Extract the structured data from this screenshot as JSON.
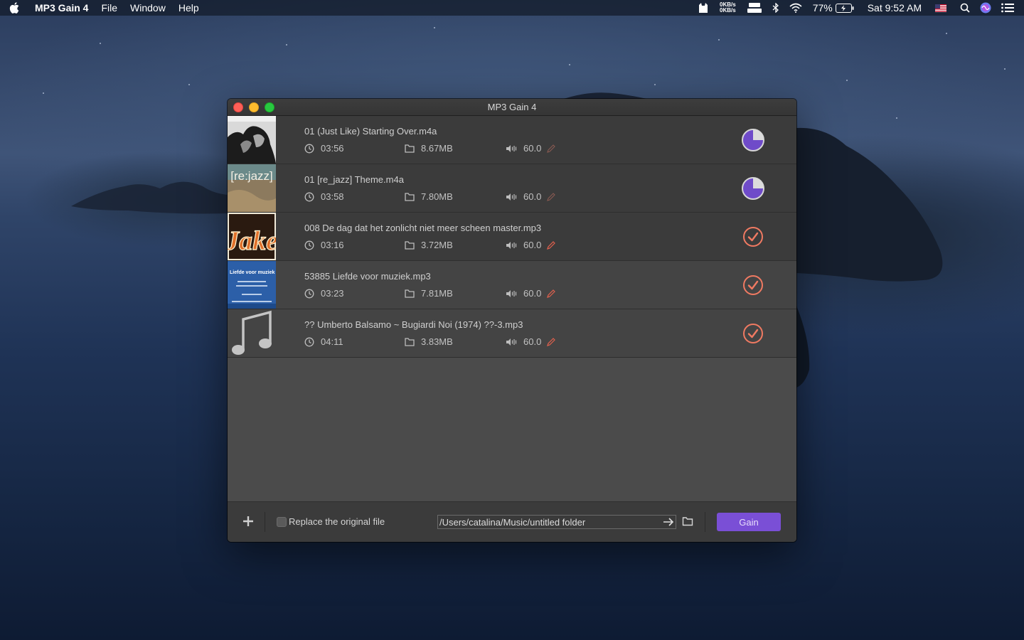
{
  "menubar": {
    "app_name": "MP3 Gain 4",
    "menus": [
      "File",
      "Window",
      "Help"
    ],
    "net_up": "0KB/s",
    "net_down": "0KB/s",
    "battery": "77%",
    "clock": "Sat 9:52 AM",
    "icons": [
      "apple-logo-icon",
      "cat-icon",
      "drive-icon",
      "bluetooth-icon",
      "wifi-icon",
      "battery-icon",
      "us-flag-icon",
      "spotlight-icon",
      "siri-icon",
      "notification-center-icon"
    ]
  },
  "window": {
    "title": "MP3 Gain 4"
  },
  "files": [
    {
      "name": "01 (Just Like) Starting Over.m4a",
      "duration": "03:56",
      "size": "8.67MB",
      "volume": "60.0",
      "status": "processing",
      "status_icon": "progress-pie-icon"
    },
    {
      "name": "01 [re_jazz] Theme.m4a",
      "duration": "03:58",
      "size": "7.80MB",
      "volume": "60.0",
      "status": "processing",
      "status_icon": "progress-pie-icon",
      "art_text": "[re:jazz]"
    },
    {
      "name": "008 De dag dat het zonlicht niet meer scheen master.mp3",
      "duration": "03:16",
      "size": "3.72MB",
      "volume": "60.0",
      "status": "done",
      "status_icon": "checkmark-circle-icon",
      "art_text": "Jake"
    },
    {
      "name": "53885 Liefde voor muziek.mp3",
      "duration": "03:23",
      "size": "7.81MB",
      "volume": "60.0",
      "status": "done",
      "status_icon": "checkmark-circle-icon",
      "art_text": "Liefde voor muziek"
    },
    {
      "name": "?? Umberto Balsamo ~ Bugiardi Noi (1974) ??-3.mp3",
      "duration": "04:11",
      "size": "3.83MB",
      "volume": "60.0",
      "status": "done",
      "status_icon": "checkmark-circle-icon"
    }
  ],
  "footer": {
    "replace_label": "Replace the original file",
    "replace_checked": false,
    "output_path": "/Users/catalina/Music/untitled folder",
    "gain_label": "Gain"
  },
  "colors": {
    "accent": "#7a4fd6",
    "done": "#f07a62",
    "pencil": "#e0604d"
  }
}
